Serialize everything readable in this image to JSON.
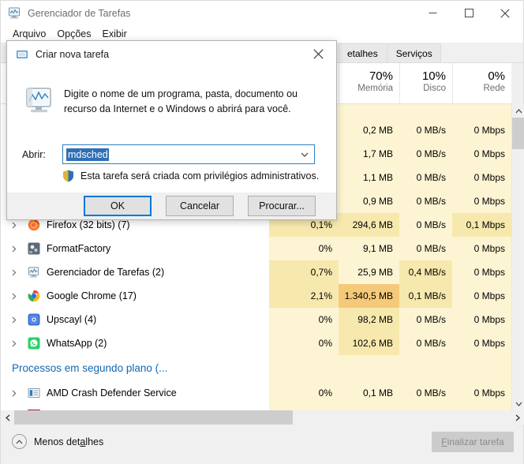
{
  "window": {
    "title": "Gerenciador de Tarefas",
    "icon": "task-manager-icon",
    "minimize": "–",
    "maximize": "☐",
    "close": "✕"
  },
  "menubar": {
    "items": [
      "Arquivo",
      "Opções",
      "Exibir"
    ]
  },
  "tabs": [
    {
      "label": "etalhes",
      "active": false
    },
    {
      "label": "Serviços",
      "active": false
    }
  ],
  "columns": [
    {
      "key": "cpu",
      "pct": "",
      "name": ""
    },
    {
      "key": "mem",
      "pct": "70%",
      "name": "Memória"
    },
    {
      "key": "disk",
      "pct": "10%",
      "name": "Disco"
    },
    {
      "key": "net",
      "pct": "0%",
      "name": "Rede"
    }
  ],
  "rows": [
    {
      "name": "",
      "icon": "",
      "cpu": "",
      "mem": "0,2 MB",
      "disk": "0 MB/s",
      "net": "0 Mbps",
      "hidden": true
    },
    {
      "name": "",
      "icon": "",
      "cpu": "",
      "mem": "1,7 MB",
      "disk": "0 MB/s",
      "net": "0 Mbps",
      "hidden": true
    },
    {
      "name": "",
      "icon": "",
      "cpu": "",
      "mem": "1,1 MB",
      "disk": "0 MB/s",
      "net": "0 Mbps",
      "hidden": true
    },
    {
      "name": "",
      "icon": "",
      "cpu": "",
      "mem": "0,9 MB",
      "disk": "0 MB/s",
      "net": "0 Mbps",
      "hidden": true
    },
    {
      "name": "Firefox (32 bits) (7)",
      "icon": "firefox-icon",
      "cpu": "0,1%",
      "mem": "294,6 MB",
      "disk": "0 MB/s",
      "net": "0,1 Mbps"
    },
    {
      "name": "FormatFactory",
      "icon": "formatfactory-icon",
      "cpu": "0%",
      "mem": "9,1 MB",
      "disk": "0 MB/s",
      "net": "0 Mbps"
    },
    {
      "name": "Gerenciador de Tarefas (2)",
      "icon": "task-manager-icon",
      "cpu": "0,7%",
      "mem": "25,9 MB",
      "disk": "0,4 MB/s",
      "net": "0 Mbps"
    },
    {
      "name": "Google Chrome (17)",
      "icon": "chrome-icon",
      "cpu": "2,1%",
      "mem": "1.340,5 MB",
      "disk": "0,1 MB/s",
      "net": "0 Mbps"
    },
    {
      "name": "Upscayl (4)",
      "icon": "upscayl-icon",
      "cpu": "0%",
      "mem": "98,2 MB",
      "disk": "0 MB/s",
      "net": "0 Mbps"
    },
    {
      "name": "WhatsApp (2)",
      "icon": "whatsapp-icon",
      "cpu": "0%",
      "mem": "102,6 MB",
      "disk": "0 MB/s",
      "net": "0 Mbps"
    }
  ],
  "group_header": "Processos em segundo plano (...",
  "bg_rows": [
    {
      "name": "AMD Crash Defender Service",
      "icon": "service-icon",
      "cpu": "0%",
      "mem": "0,1 MB",
      "disk": "0 MB/s",
      "net": "0 Mbps"
    }
  ],
  "status": {
    "less_details_pre": "Menos det",
    "less_details_key": "a",
    "less_details_post": "lhes",
    "end_task_key": "F",
    "end_task_rest": "inalizar tarefa"
  },
  "dialog": {
    "title": "Criar nova tarefa",
    "icon": "new-task-icon",
    "close": "✕",
    "description": "Digite o nome de um programa, pasta, documento ou recurso da Internet e o Windows o abrirá para você.",
    "open_label": "Abrir:",
    "input_value": "mdsched",
    "input_placeholder": "",
    "caret": "⌄",
    "uac_text": "Esta tarefa será criada com privilégios administrativos.",
    "buttons": {
      "ok": "OK",
      "cancel": "Cancelar",
      "browse": "Procurar..."
    }
  },
  "colors": {
    "accent": "#0078d7",
    "group_header_text": "#1268b3",
    "heat_light": "#fdf4d3",
    "heat_mid": "#f7e9ae",
    "heat_strong": "#f5c97a",
    "selection": "#2f6fb5"
  }
}
